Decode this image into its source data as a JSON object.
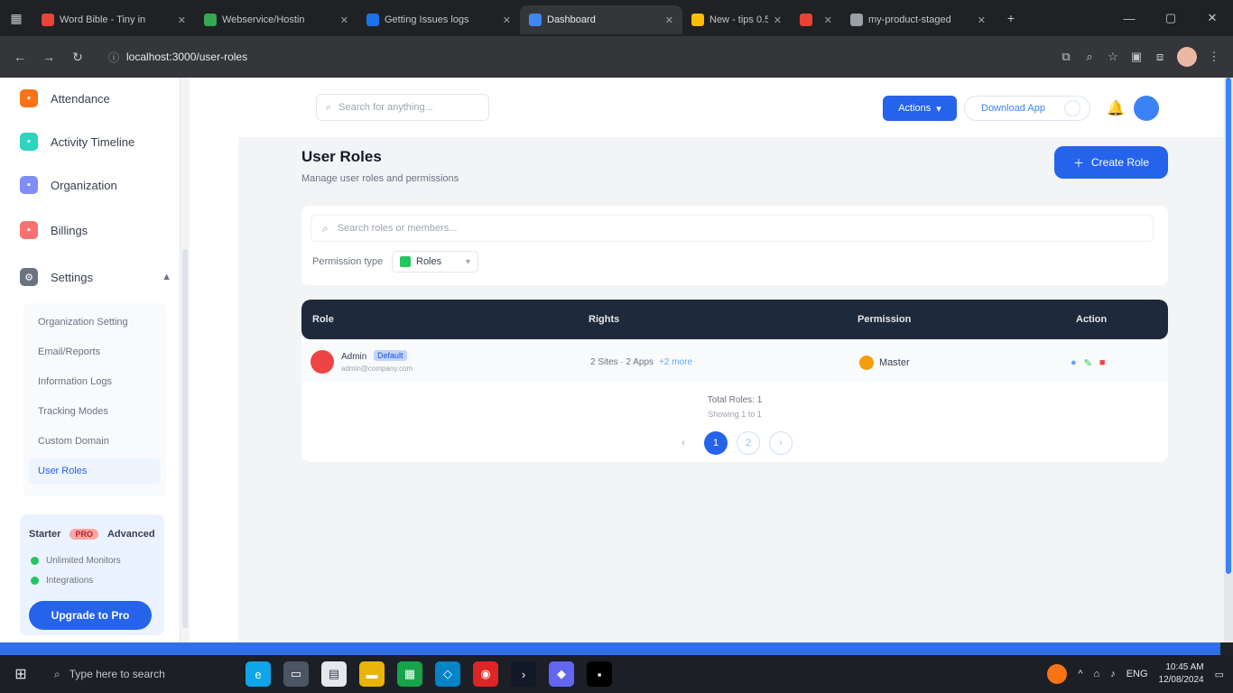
{
  "browser": {
    "tabs": [
      {
        "title": "Word Bible - Tiny in",
        "color": "#e8453c"
      },
      {
        "title": "Webservice/Hostin",
        "color": "#34a853"
      },
      {
        "title": "Getting Issues logs",
        "color": "#1a73e8"
      },
      {
        "title": "Dashboard",
        "color": "#4285f4"
      },
      {
        "title": "New - tips 0.5",
        "color": "#fbbc04"
      },
      {
        "title": "",
        "color": "#ea4335"
      },
      {
        "title": "my-product-staged",
        "color": "#9aa0a6"
      }
    ],
    "url": "localhost:3000/user-roles"
  },
  "sidebar": {
    "items": [
      {
        "label": "Attendance",
        "color": "#f97316",
        "icon": "calendar-icon"
      },
      {
        "label": "Activity Timeline",
        "color": "#2dd4bf",
        "icon": "timeline-icon"
      },
      {
        "label": "Organization",
        "color": "#818cf8",
        "icon": "building-icon"
      },
      {
        "label": "Billings",
        "color": "#f87171",
        "icon": "billing-icon"
      },
      {
        "label": "Settings",
        "color": "#6b7280",
        "icon": "gear-icon"
      }
    ],
    "submenu": [
      "Organization Setting",
      "Email/Reports",
      "Information Logs",
      "Tracking Modes",
      "Custom Domain",
      "User Roles"
    ],
    "promo": {
      "plan": "Starter",
      "badge": "PRO",
      "next": "Advanced",
      "features": [
        "Unlimited Monitors",
        "Integrations"
      ],
      "button": "Upgrade to Pro"
    }
  },
  "header": {
    "search_placeholder": "Search for anything...",
    "actions_button": "Actions",
    "download_button": "Download App"
  },
  "main": {
    "title": "User Roles",
    "subtitle": "Manage user roles and permissions",
    "create_button": "Create Role",
    "filter": {
      "search_placeholder": "Search roles or members...",
      "label": "Permission type",
      "selected": "Roles"
    },
    "table": {
      "columns": [
        "Role",
        "Rights",
        "Permission",
        "Action"
      ],
      "rows": [
        {
          "name": "Admin",
          "badge": "Default",
          "email": "admin@company.com",
          "rights": "2 Sites · 2 Apps",
          "rights_link": "+2 more",
          "permission": "Master"
        }
      ]
    },
    "pagination": {
      "info": "Total Roles: 1",
      "sub": "Showing 1 to 1",
      "pages": [
        "‹",
        "1",
        "2",
        "›"
      ]
    }
  },
  "taskbar": {
    "search_placeholder": "Type here to search",
    "time": "10:45 AM",
    "date": "12/08/2024",
    "lang": "ENG"
  }
}
